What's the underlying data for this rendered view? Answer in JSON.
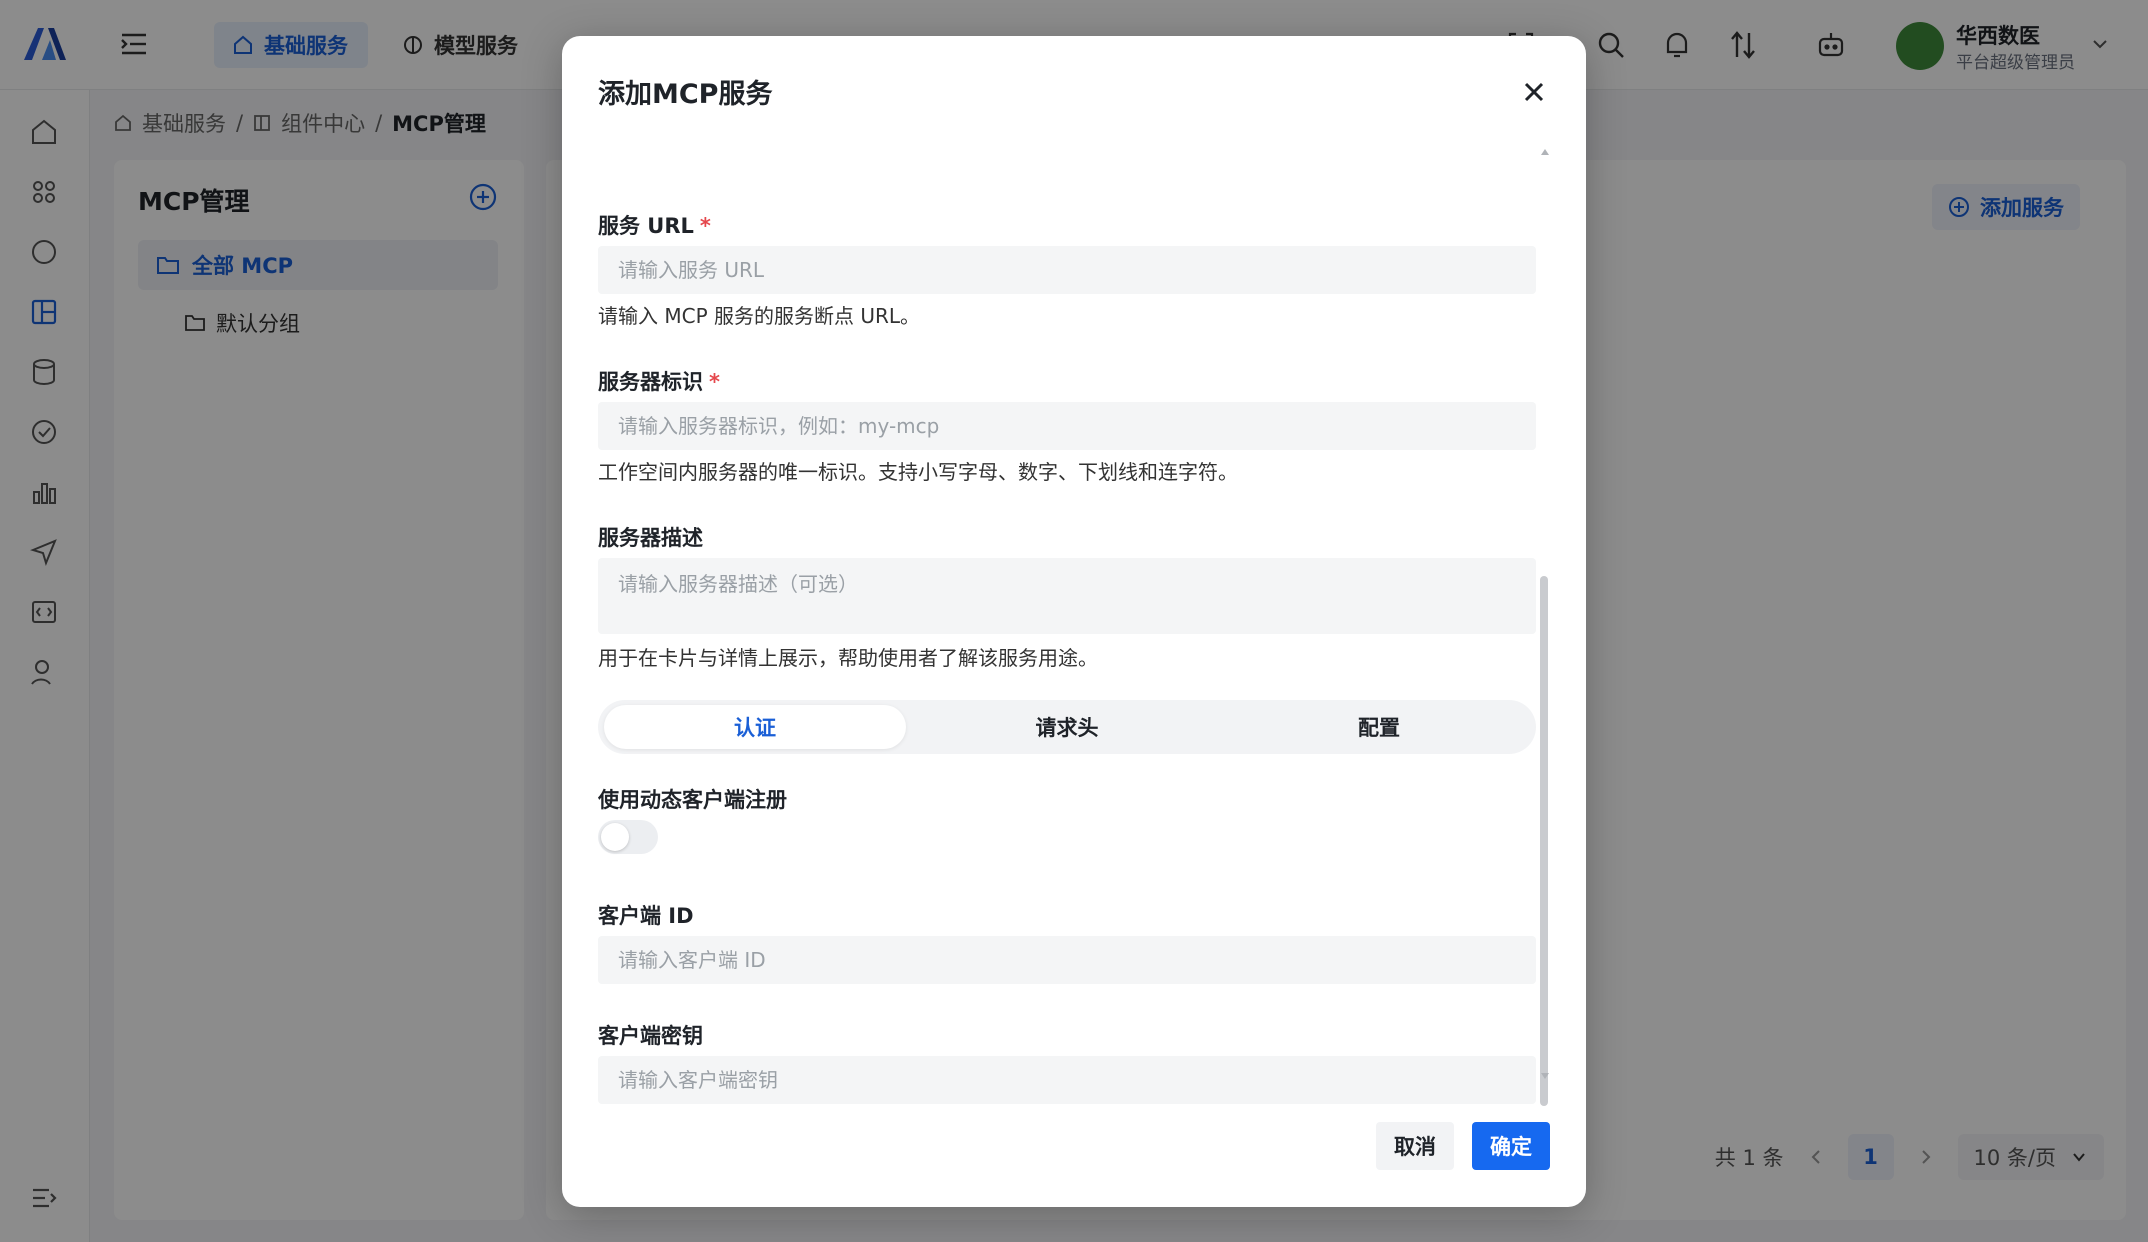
{
  "topbar": {
    "tabs": [
      {
        "label": "基础服务",
        "icon": "home-icon",
        "active": true
      },
      {
        "label": "模型服务",
        "icon": "brain-icon",
        "active": false
      }
    ],
    "user": {
      "name": "华西数医",
      "role": "平台超级管理员"
    }
  },
  "breadcrumb": {
    "items": [
      "基础服务",
      "组件中心"
    ],
    "separator": "/",
    "current": "MCP管理"
  },
  "left_panel": {
    "title": "MCP管理",
    "tree": {
      "all": "全部 MCP",
      "default_group": "默认分组"
    }
  },
  "right_panel": {
    "add_button": "添加服务",
    "pagination": {
      "total": "共 1 条",
      "current_page": "1",
      "page_size": "10 条/页"
    }
  },
  "modal": {
    "title": "添加MCP服务",
    "fields": {
      "url": {
        "label": "服务 URL",
        "required_mark": "*",
        "placeholder": "请输入服务 URL",
        "help": "请输入 MCP 服务的服务断点 URL。"
      },
      "identifier": {
        "label": "服务器标识",
        "required_mark": "*",
        "placeholder": "请输入服务器标识，例如：my-mcp",
        "help": "工作空间内服务器的唯一标识。支持小写字母、数字、下划线和连字符。"
      },
      "description": {
        "label": "服务器描述",
        "placeholder": "请输入服务器描述（可选）",
        "help": "用于在卡片与详情上展示，帮助使用者了解该服务用途。"
      }
    },
    "tabs": [
      {
        "label": "认证",
        "active": true
      },
      {
        "label": "请求头",
        "active": false
      },
      {
        "label": "配置",
        "active": false
      }
    ],
    "auth": {
      "dynamic_registration": {
        "label": "使用动态客户端注册",
        "enabled": false
      },
      "client_id": {
        "label": "客户端 ID",
        "placeholder": "请输入客户端 ID"
      },
      "client_secret": {
        "label": "客户端密钥",
        "placeholder": "请输入客户端密钥"
      }
    },
    "buttons": {
      "cancel": "取消",
      "confirm": "确定"
    }
  },
  "colors": {
    "accent": "#1669f0",
    "required": "#e5484d",
    "brand_logo": "#2a5bd7"
  }
}
